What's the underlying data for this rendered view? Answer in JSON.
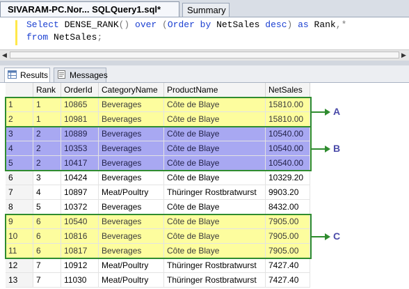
{
  "tabs": {
    "active": "SIVARAM-PC.Nor... SQLQuery1.sql*",
    "summary": "Summary"
  },
  "query": {
    "line1": [
      {
        "t": "Select ",
        "k": "kw"
      },
      {
        "t": "DENSE_RANK",
        "k": "pl"
      },
      {
        "t": "() ",
        "k": "gr"
      },
      {
        "t": "over ",
        "k": "kw"
      },
      {
        "t": "(",
        "k": "gr"
      },
      {
        "t": "Order by ",
        "k": "kw"
      },
      {
        "t": "NetSales ",
        "k": "pl"
      },
      {
        "t": "desc",
        "k": "kw"
      },
      {
        "t": ") ",
        "k": "gr"
      },
      {
        "t": "as ",
        "k": "kw"
      },
      {
        "t": "Rank",
        "k": "pl"
      },
      {
        "t": ",",
        "k": "gr"
      },
      {
        "t": "*",
        "k": "gr"
      }
    ],
    "line2": [
      {
        "t": "from ",
        "k": "kw"
      },
      {
        "t": "NetSales",
        "k": "pl"
      },
      {
        "t": ";",
        "k": "gr"
      }
    ]
  },
  "result_tabs": {
    "results": "Results",
    "messages": "Messages"
  },
  "grid": {
    "columns": [
      "",
      "Rank",
      "OrderId",
      "CategoryName",
      "ProductName",
      "NetSales"
    ],
    "rows": [
      [
        "1",
        "1",
        "10865",
        "Beverages",
        "Côte de Blaye",
        "15810.00"
      ],
      [
        "2",
        "1",
        "10981",
        "Beverages",
        "Côte de Blaye",
        "15810.00"
      ],
      [
        "3",
        "2",
        "10889",
        "Beverages",
        "Côte de Blaye",
        "10540.00"
      ],
      [
        "4",
        "2",
        "10353",
        "Beverages",
        "Côte de Blaye",
        "10540.00"
      ],
      [
        "5",
        "2",
        "10417",
        "Beverages",
        "Côte de Blaye",
        "10540.00"
      ],
      [
        "6",
        "3",
        "10424",
        "Beverages",
        "Côte de Blaye",
        "10329.20"
      ],
      [
        "7",
        "4",
        "10897",
        "Meat/Poultry",
        "Thüringer Rostbratwurst",
        "9903.20"
      ],
      [
        "8",
        "5",
        "10372",
        "Beverages",
        "Côte de Blaye",
        "8432.00"
      ],
      [
        "9",
        "6",
        "10540",
        "Beverages",
        "Côte de Blaye",
        "7905.00"
      ],
      [
        "10",
        "6",
        "10816",
        "Beverages",
        "Côte de Blaye",
        "7905.00"
      ],
      [
        "11",
        "6",
        "10817",
        "Beverages",
        "Côte de Blaye",
        "7905.00"
      ],
      [
        "12",
        "7",
        "10912",
        "Meat/Poultry",
        "Thüringer Rostbratwurst",
        "7427.40"
      ],
      [
        "13",
        "7",
        "11030",
        "Meat/Poultry",
        "Thüringer Rostbratwurst",
        "7427.40"
      ]
    ],
    "highlight": [
      "yellow",
      "yellow",
      "blue",
      "blue",
      "blue",
      "",
      "",
      "",
      "yellow",
      "yellow",
      "yellow",
      "",
      ""
    ]
  },
  "annotations": [
    {
      "label": "A",
      "color": "#2f8c2f"
    },
    {
      "label": "B",
      "color": "#2f8c2f"
    },
    {
      "label": "C",
      "color": "#2f8c2f"
    }
  ],
  "colors": {
    "yellow": "#fdfd9e",
    "blue": "#a8a8f2",
    "annotation": "#2f8c2f",
    "keyword": "#1a3fd1"
  }
}
